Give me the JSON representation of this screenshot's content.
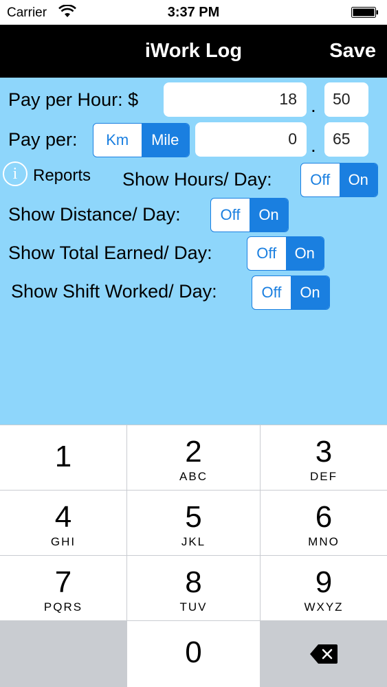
{
  "status_bar": {
    "carrier": "Carrier",
    "time": "3:37 PM",
    "wifi_icon": "wifi-icon",
    "battery_icon": "battery-icon"
  },
  "nav": {
    "title": "iWork Log",
    "save_label": "Save"
  },
  "form": {
    "pay_per_hour": {
      "label": "Pay per Hour: $",
      "whole": "18",
      "separator": ".",
      "cents": "50"
    },
    "pay_per_distance": {
      "label": "Pay per:",
      "units": [
        "Km",
        "Mile"
      ],
      "selected_unit": "Mile",
      "whole": "0",
      "separator": ".",
      "cents": "65"
    },
    "reports": {
      "label": "Reports",
      "icon": "info-icon"
    },
    "toggles": [
      {
        "label": "Show Hours/ Day:",
        "off": "Off",
        "on": "On",
        "selected": "On"
      },
      {
        "label": "Show Distance/ Day:",
        "off": "Off",
        "on": "On",
        "selected": "On"
      },
      {
        "label": "Show Total Earned/ Day:",
        "off": "Off",
        "on": "On",
        "selected": "On"
      },
      {
        "label": "Show Shift Worked/ Day:",
        "off": "Off",
        "on": "On",
        "selected": "On"
      }
    ]
  },
  "keypad": {
    "keys": [
      {
        "num": "1",
        "letters": ""
      },
      {
        "num": "2",
        "letters": "ABC"
      },
      {
        "num": "3",
        "letters": "DEF"
      },
      {
        "num": "4",
        "letters": "GHI"
      },
      {
        "num": "5",
        "letters": "JKL"
      },
      {
        "num": "6",
        "letters": "MNO"
      },
      {
        "num": "7",
        "letters": "PQRS"
      },
      {
        "num": "8",
        "letters": "TUV"
      },
      {
        "num": "9",
        "letters": "WXYZ"
      },
      {
        "num": "0",
        "letters": ""
      }
    ],
    "delete_icon": "backspace-icon"
  },
  "colors": {
    "background": "#8ed6fb",
    "accent": "#1a7fe0",
    "nav": "#000000"
  }
}
